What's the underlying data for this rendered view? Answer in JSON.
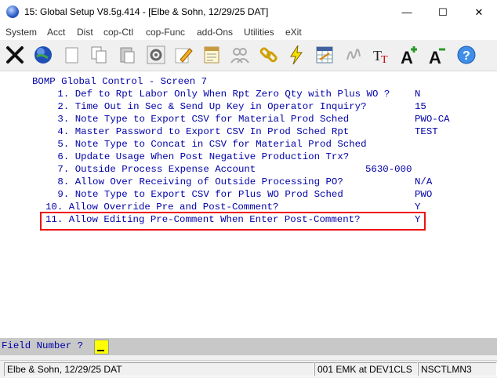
{
  "window": {
    "title": "15: Global Setup V8.5g.414 - [Elbe & Sohn, 12/29/25 DAT]",
    "minimize": "—",
    "maximize": "☐",
    "close": "✕"
  },
  "menu": [
    "System",
    "Acct",
    "Dist",
    "cop-Ctl",
    "cop-Func",
    "add-Ons",
    "Utilities",
    "eXit"
  ],
  "toolbar_icons": [
    "close-x-icon",
    "globe-icon",
    "blank-page-icon",
    "copy-icon",
    "paste-icon",
    "settings-gear-icon",
    "edit-pencil-icon",
    "notepad-icon",
    "users-icon",
    "chain-link-icon",
    "lightning-icon",
    "spreadsheet-icon",
    "signature-icon",
    "font-icon",
    "font-increase-icon",
    "font-decrease-icon",
    "help-icon"
  ],
  "screen": {
    "header": "BOMP Global Control - Screen 7",
    "lines": [
      {
        "text": " 1. Def to Rpt Labor Only When Rpt Zero Qty with Plus WO ?",
        "value": "N"
      },
      {
        "text": " 2. Time Out in Sec & Send Up Key in Operator Inquiry?",
        "value": "15"
      },
      {
        "text": " 3. Note Type to Export CSV for Material Prod Sched",
        "value": "PWO-CA"
      },
      {
        "text": " 4. Master Password to Export CSV In Prod Sched Rpt",
        "value": "TEST"
      },
      {
        "text": " 5. Note Type to Concat in CSV for Material Prod Sched",
        "value": ""
      },
      {
        "text": " 6. Update Usage When Post Negative Production Trx?",
        "value": ""
      },
      {
        "text": " 7. Outside Process Expense Account",
        "value": "5630-000"
      },
      {
        "text": " 8. Allow Over Receiving of Outside Processing PO?",
        "value": "N/A"
      },
      {
        "text": " 9. Note Type to Export CSV for Plus WO Prod Sched",
        "value": "PWO"
      },
      {
        "text": "10. Allow Override Pre and Post-Comment?",
        "value": "Y"
      },
      {
        "text": "11. Allow Editing Pre-Comment When Enter Post-Comment?",
        "value": "Y"
      }
    ]
  },
  "prompt": "Field Number ?",
  "status": {
    "company": "Elbe & Sohn, 12/29/25 DAT",
    "user": "001 EMK at DEV1CLS",
    "code": "NSCTLMN3"
  }
}
